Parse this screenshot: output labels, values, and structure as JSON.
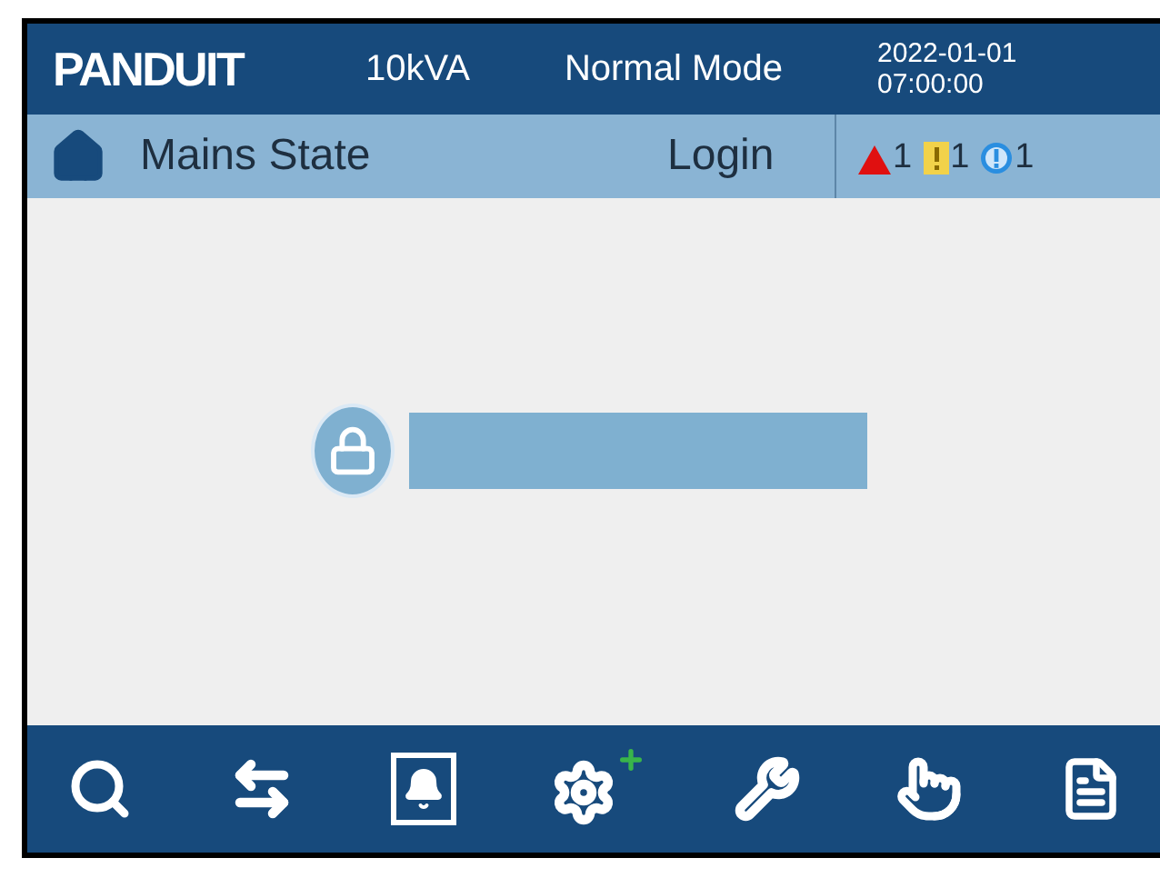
{
  "header": {
    "logo": "PANDUIT",
    "capacity": "10kVA",
    "mode": "Normal Mode",
    "date": "2022-01-01",
    "time": "07:00:00"
  },
  "subheader": {
    "title": "Mains State",
    "login": "Login"
  },
  "alarms": [
    {
      "kind": "critical",
      "count": "1"
    },
    {
      "kind": "warning",
      "count": "1"
    },
    {
      "kind": "info",
      "count": "1"
    }
  ],
  "toolbar": [
    {
      "kind": "search"
    },
    {
      "kind": "transfer"
    },
    {
      "kind": "alarm"
    },
    {
      "kind": "settings"
    },
    {
      "kind": "tools"
    },
    {
      "kind": "touch"
    },
    {
      "kind": "log"
    }
  ]
}
